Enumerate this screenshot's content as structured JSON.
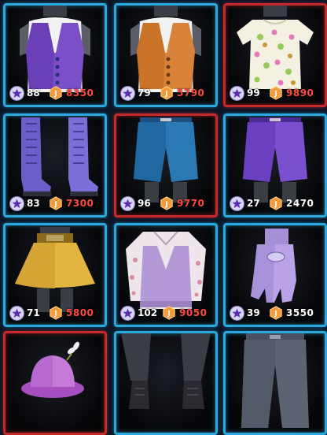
{
  "colors": {
    "frame": "#29a9df",
    "selected_frame": "#c42a2a",
    "price_unaffordable": "#ff4a3c",
    "price_affordable": "#ffffff",
    "level_badge": "#d8d4f2",
    "currency_badge": "#f29b38"
  },
  "icons": {
    "level": "star-icon",
    "currency": "j-coin-icon"
  },
  "items": [
    {
      "name": "purple-vest",
      "level": "88",
      "price": "8350",
      "affordable": false,
      "selected": false
    },
    {
      "name": "orange-vest",
      "level": "79",
      "price": "5790",
      "affordable": false,
      "selected": false
    },
    {
      "name": "daisy-print-tee",
      "level": "99",
      "price": "9890",
      "affordable": false,
      "selected": true
    },
    {
      "name": "purple-lace-up-boots",
      "level": "83",
      "price": "7300",
      "affordable": false,
      "selected": false
    },
    {
      "name": "blue-shorts",
      "level": "96",
      "price": "9770",
      "affordable": false,
      "selected": true
    },
    {
      "name": "purple-shorts",
      "level": "27",
      "price": "2470",
      "affordable": true,
      "selected": false
    },
    {
      "name": "gold-skirt",
      "level": "71",
      "price": "5800",
      "affordable": false,
      "selected": false
    },
    {
      "name": "lilac-sweater-vest",
      "level": "102",
      "price": "9050",
      "affordable": false,
      "selected": false
    },
    {
      "name": "lilac-glove",
      "level": "39",
      "price": "3550",
      "affordable": true,
      "selected": false
    },
    {
      "name": "lilac-hat",
      "level": "",
      "price": "",
      "affordable": false,
      "selected": true
    },
    {
      "name": "dark-boots",
      "level": "",
      "price": "",
      "affordable": false,
      "selected": false
    },
    {
      "name": "dark-jeans",
      "level": "",
      "price": "",
      "affordable": false,
      "selected": false
    }
  ]
}
